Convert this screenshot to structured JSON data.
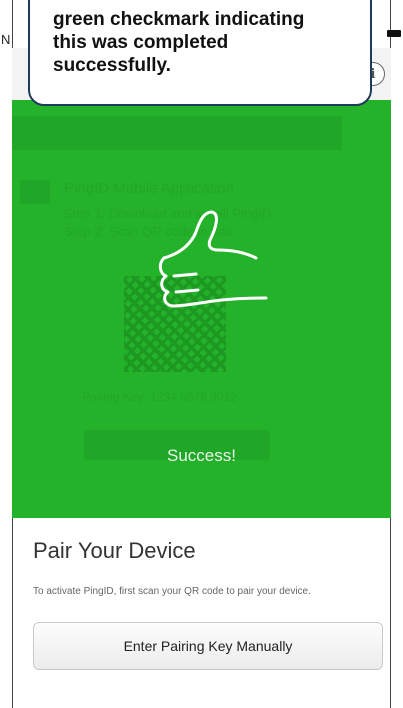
{
  "callout": {
    "lines": [
      "green checkmark indicating",
      "this was completed",
      "successfully."
    ]
  },
  "status": {
    "carrier_letter": "N"
  },
  "topbar": {
    "info_icon": "i"
  },
  "background_ghost": {
    "title": "PingID Mobile Application",
    "line1": "Step 1: Download and install PingID",
    "line2": "Step 2: Scan QR code to pair",
    "pairing_key": "Pairing Key: 1234 5678 9012"
  },
  "overlay": {
    "icon": "thumbs-up-icon",
    "success_text": "Success!",
    "color": "#25b22b"
  },
  "pair": {
    "title": "Pair Your Device",
    "description": "To activate PingID, first scan your QR code to pair your device.",
    "button_label": "Enter Pairing Key Manually"
  }
}
